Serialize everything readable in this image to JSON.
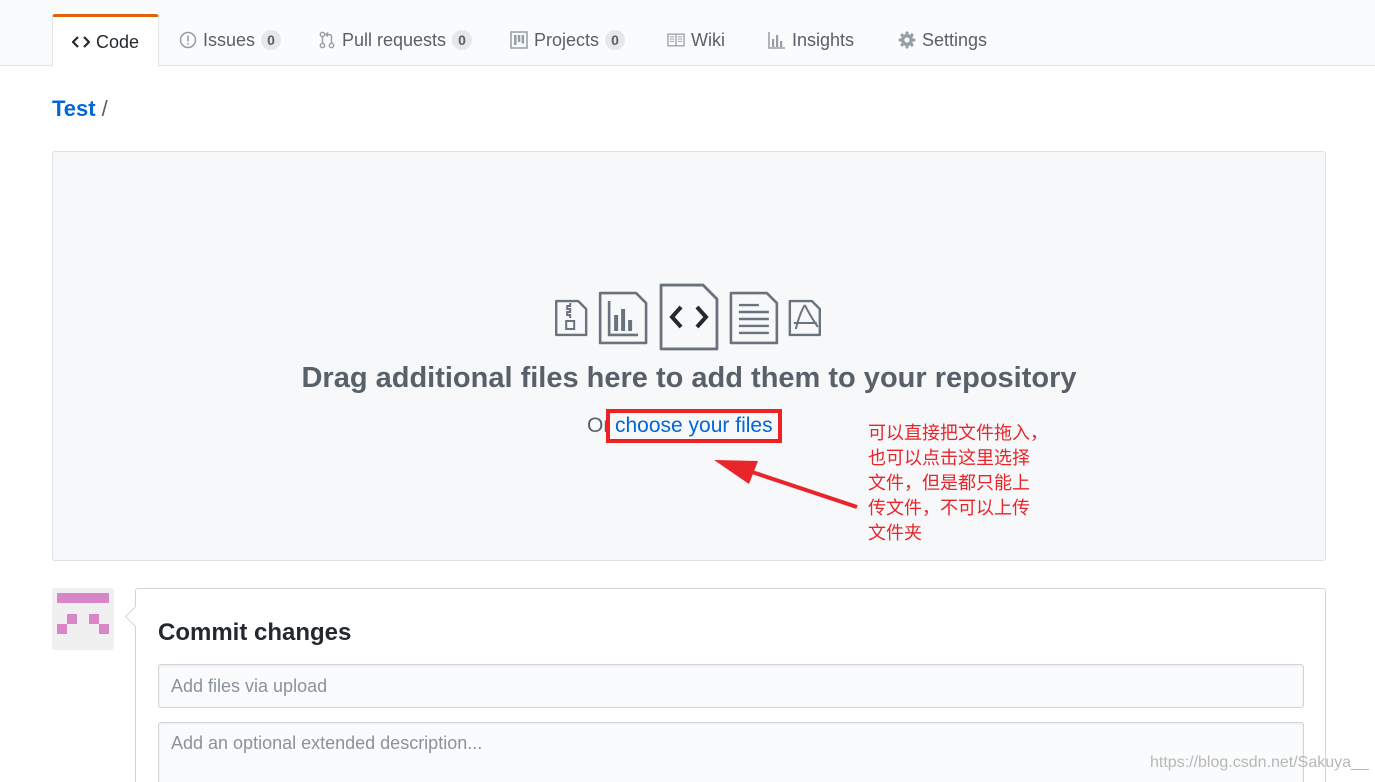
{
  "tabs": [
    {
      "label": "Code",
      "icon": "code-icon",
      "selected": true
    },
    {
      "label": "Issues",
      "icon": "issue-opened-icon",
      "count": "0"
    },
    {
      "label": "Pull requests",
      "icon": "git-pull-request-icon",
      "count": "0"
    },
    {
      "label": "Projects",
      "icon": "project-icon",
      "count": "0"
    },
    {
      "label": "Wiki",
      "icon": "book-icon"
    },
    {
      "label": "Insights",
      "icon": "graph-icon"
    },
    {
      "label": "Settings",
      "icon": "gear-icon"
    }
  ],
  "breadcrumb": {
    "repo": "Test",
    "separator": "/"
  },
  "dropzone": {
    "icons": [
      "file-zip-icon",
      "file-chart-icon",
      "file-code-icon",
      "file-text-icon",
      "file-pdf-icon"
    ],
    "title": "Drag additional files here to add them to your repository",
    "or_text": "Or",
    "choose_link": "choose your files"
  },
  "annotation": {
    "lines": [
      "可以直接把文件拖入，",
      "也可以点击这里选择",
      "文件，但是都只能上",
      "传文件，不可以上传",
      "文件夹"
    ],
    "color": "#e8252a"
  },
  "commit": {
    "title": "Commit changes",
    "summary_placeholder": "Add files via upload",
    "description_placeholder": "Add an optional extended description..."
  },
  "watermark": "https://blog.csdn.net/Sakuya__",
  "colors": {
    "accent": "#e36209",
    "link": "#0366d6",
    "annotation": "#e8252a",
    "avatar": "#d986c8"
  }
}
